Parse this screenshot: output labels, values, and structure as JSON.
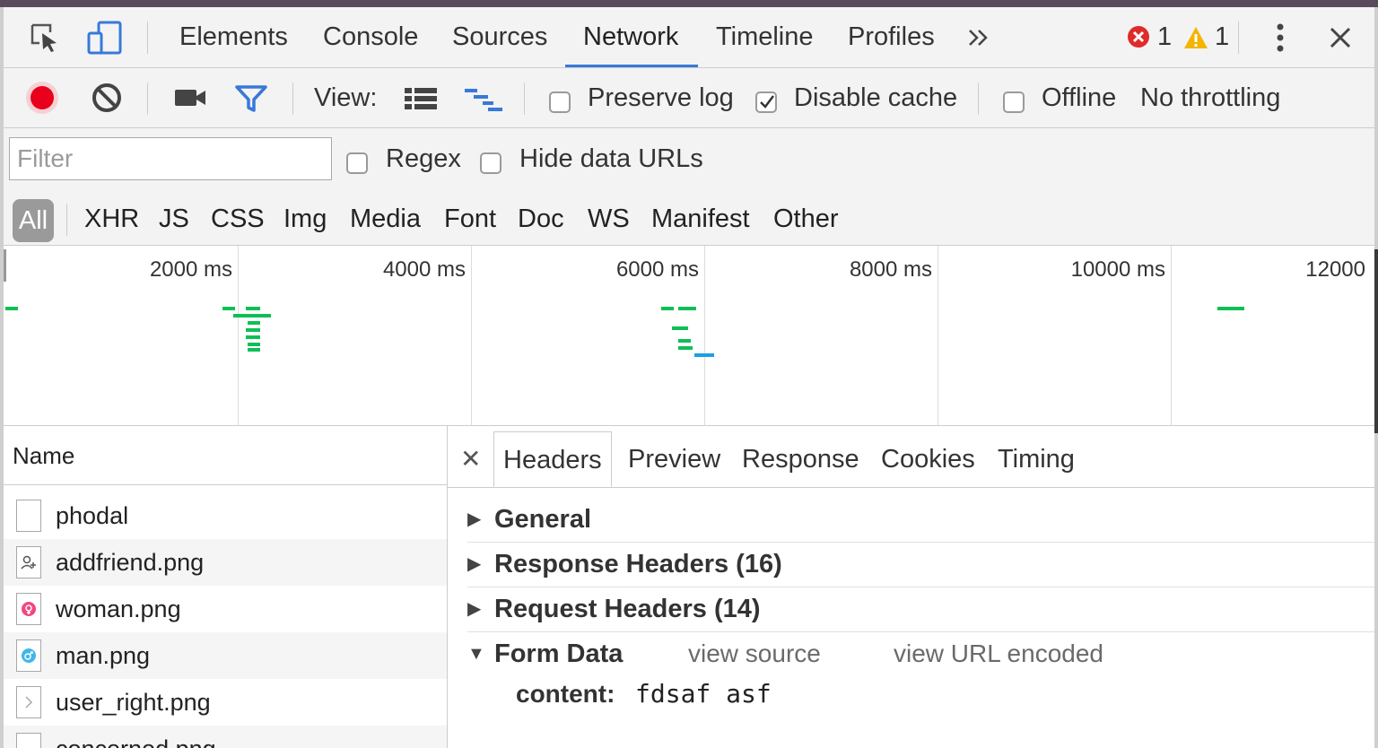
{
  "tabbar": {
    "tabs": [
      "Elements",
      "Console",
      "Sources",
      "Network",
      "Timeline",
      "Profiles"
    ],
    "active": "Network",
    "overflow_icon": "chevron-double-right-icon",
    "error_count": "1",
    "warning_count": "1"
  },
  "toolbar": {
    "view_label": "View:",
    "preserve_log": "Preserve log",
    "disable_cache": "Disable cache",
    "disable_cache_checked": true,
    "offline": "Offline",
    "throttling": "No throttling",
    "record_color": "#e8001c",
    "filter_icon_color": "#3879d9"
  },
  "filter": {
    "placeholder": "Filter",
    "regex": "Regex",
    "hide_data_urls": "Hide data URLs",
    "types": [
      "All",
      "XHR",
      "JS",
      "CSS",
      "Img",
      "Media",
      "Font",
      "Doc",
      "WS",
      "Manifest",
      "Other"
    ],
    "active_type": "All"
  },
  "overview": {
    "labels": [
      "2000 ms",
      "4000 ms",
      "6000 ms",
      "8000 ms",
      "10000 ms",
      "12000"
    ],
    "bar_colors": {
      "green": "#0fbf56",
      "blue": "#1e9ee0"
    }
  },
  "requests": {
    "header": "Name",
    "rows": [
      "phodal",
      "addfriend.png",
      "woman.png",
      "man.png",
      "user_right.png",
      "concerned.png"
    ]
  },
  "details": {
    "tabs": [
      "Headers",
      "Preview",
      "Response",
      "Cookies",
      "Timing"
    ],
    "active_tab": "Headers",
    "sections": {
      "general": "General",
      "response_headers": "Response Headers (16)",
      "request_headers": "Request Headers (14)",
      "form_data": "Form Data"
    },
    "form_links": {
      "view_source": "view source",
      "view_url_encoded": "view URL encoded"
    },
    "form_field": {
      "key": "content:",
      "value": "fdsaf asf"
    }
  }
}
